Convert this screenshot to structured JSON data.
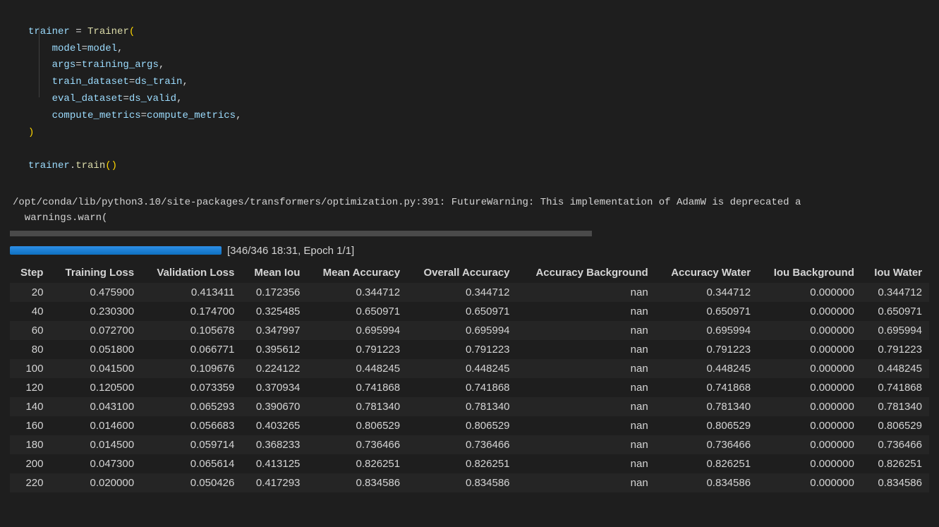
{
  "code": {
    "line1_a": "trainer",
    "line1_b": " = ",
    "line1_c": "Trainer",
    "line1_d": "(",
    "line2_a": "model",
    "line2_b": "=",
    "line2_c": "model",
    "line2_d": ",",
    "line3_a": "args",
    "line3_b": "=",
    "line3_c": "training_args",
    "line3_d": ",",
    "line4_a": "train_dataset",
    "line4_b": "=",
    "line4_c": "ds_train",
    "line4_d": ",",
    "line5_a": "eval_dataset",
    "line5_b": "=",
    "line5_c": "ds_valid",
    "line5_d": ",",
    "line6_a": "compute_metrics",
    "line6_b": "=",
    "line6_c": "compute_metrics",
    "line6_d": ",",
    "line7": ")",
    "line8_a": "trainer",
    "line8_b": ".",
    "line8_c": "train",
    "line8_d": "()"
  },
  "warning": {
    "line1": "/opt/conda/lib/python3.10/site-packages/transformers/optimization.py:391: FutureWarning: This implementation of AdamW is deprecated a",
    "line2": "  warnings.warn("
  },
  "progress": {
    "label": "[346/346 18:31, Epoch 1/1]"
  },
  "table": {
    "headers": [
      "Step",
      "Training Loss",
      "Validation Loss",
      "Mean Iou",
      "Mean Accuracy",
      "Overall Accuracy",
      "Accuracy Background",
      "Accuracy Water",
      "Iou Background",
      "Iou Water"
    ],
    "rows": [
      [
        "20",
        "0.475900",
        "0.413411",
        "0.172356",
        "0.344712",
        "0.344712",
        "nan",
        "0.344712",
        "0.000000",
        "0.344712"
      ],
      [
        "40",
        "0.230300",
        "0.174700",
        "0.325485",
        "0.650971",
        "0.650971",
        "nan",
        "0.650971",
        "0.000000",
        "0.650971"
      ],
      [
        "60",
        "0.072700",
        "0.105678",
        "0.347997",
        "0.695994",
        "0.695994",
        "nan",
        "0.695994",
        "0.000000",
        "0.695994"
      ],
      [
        "80",
        "0.051800",
        "0.066771",
        "0.395612",
        "0.791223",
        "0.791223",
        "nan",
        "0.791223",
        "0.000000",
        "0.791223"
      ],
      [
        "100",
        "0.041500",
        "0.109676",
        "0.224122",
        "0.448245",
        "0.448245",
        "nan",
        "0.448245",
        "0.000000",
        "0.448245"
      ],
      [
        "120",
        "0.120500",
        "0.073359",
        "0.370934",
        "0.741868",
        "0.741868",
        "nan",
        "0.741868",
        "0.000000",
        "0.741868"
      ],
      [
        "140",
        "0.043100",
        "0.065293",
        "0.390670",
        "0.781340",
        "0.781340",
        "nan",
        "0.781340",
        "0.000000",
        "0.781340"
      ],
      [
        "160",
        "0.014600",
        "0.056683",
        "0.403265",
        "0.806529",
        "0.806529",
        "nan",
        "0.806529",
        "0.000000",
        "0.806529"
      ],
      [
        "180",
        "0.014500",
        "0.059714",
        "0.368233",
        "0.736466",
        "0.736466",
        "nan",
        "0.736466",
        "0.000000",
        "0.736466"
      ],
      [
        "200",
        "0.047300",
        "0.065614",
        "0.413125",
        "0.826251",
        "0.826251",
        "nan",
        "0.826251",
        "0.000000",
        "0.826251"
      ],
      [
        "220",
        "0.020000",
        "0.050426",
        "0.417293",
        "0.834586",
        "0.834586",
        "nan",
        "0.834586",
        "0.000000",
        "0.834586"
      ]
    ]
  },
  "chart_data": {
    "type": "table",
    "title": "Training Metrics",
    "columns": [
      "Step",
      "Training Loss",
      "Validation Loss",
      "Mean Iou",
      "Mean Accuracy",
      "Overall Accuracy",
      "Accuracy Background",
      "Accuracy Water",
      "Iou Background",
      "Iou Water"
    ],
    "rows": [
      [
        20,
        0.4759,
        0.413411,
        0.172356,
        0.344712,
        0.344712,
        null,
        0.344712,
        0.0,
        0.344712
      ],
      [
        40,
        0.2303,
        0.1747,
        0.325485,
        0.650971,
        0.650971,
        null,
        0.650971,
        0.0,
        0.650971
      ],
      [
        60,
        0.0727,
        0.105678,
        0.347997,
        0.695994,
        0.695994,
        null,
        0.695994,
        0.0,
        0.695994
      ],
      [
        80,
        0.0518,
        0.066771,
        0.395612,
        0.791223,
        0.791223,
        null,
        0.791223,
        0.0,
        0.791223
      ],
      [
        100,
        0.0415,
        0.109676,
        0.224122,
        0.448245,
        0.448245,
        null,
        0.448245,
        0.0,
        0.448245
      ],
      [
        120,
        0.1205,
        0.073359,
        0.370934,
        0.741868,
        0.741868,
        null,
        0.741868,
        0.0,
        0.741868
      ],
      [
        140,
        0.0431,
        0.065293,
        0.39067,
        0.78134,
        0.78134,
        null,
        0.78134,
        0.0,
        0.78134
      ],
      [
        160,
        0.0146,
        0.056683,
        0.403265,
        0.806529,
        0.806529,
        null,
        0.806529,
        0.0,
        0.806529
      ],
      [
        180,
        0.0145,
        0.059714,
        0.368233,
        0.736466,
        0.736466,
        null,
        0.736466,
        0.0,
        0.736466
      ],
      [
        200,
        0.0473,
        0.065614,
        0.413125,
        0.826251,
        0.826251,
        null,
        0.826251,
        0.0,
        0.826251
      ],
      [
        220,
        0.02,
        0.050426,
        0.417293,
        0.834586,
        0.834586,
        null,
        0.834586,
        0.0,
        0.834586
      ]
    ]
  }
}
